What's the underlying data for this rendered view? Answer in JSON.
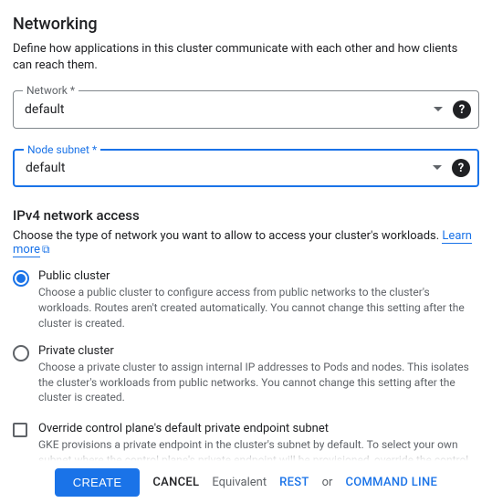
{
  "title": "Networking",
  "description": "Define how applications in this cluster communicate with each other and how clients can reach them.",
  "network_field": {
    "label": "Network *",
    "value": "default"
  },
  "subnet_field": {
    "label": "Node subnet *",
    "value": "default"
  },
  "ipv4": {
    "heading": "IPv4 network access",
    "desc": "Choose the type of network you want to allow to access your cluster's workloads.",
    "learn_more": "Learn more",
    "public": {
      "label": "Public cluster",
      "desc": "Choose a public cluster to configure access from public networks to the cluster's workloads. Routes aren't created automatically. You cannot change this setting after the cluster is created."
    },
    "private": {
      "label": "Private cluster",
      "desc": "Choose a private cluster to assign internal IP addresses to Pods and nodes. This isolates the cluster's workloads from public networks. You cannot change this setting after the cluster is created."
    }
  },
  "override": {
    "label": "Override control plane's default private endpoint subnet",
    "desc": "GKE provisions a private endpoint in the cluster's subnet by default. To select your own subnet where the control plane's private endpoint will be provisioned, override the control"
  },
  "footer": {
    "create": "CREATE",
    "cancel": "CANCEL",
    "equivalent": "Equivalent",
    "rest": "REST",
    "or": "or",
    "cmdline": "COMMAND LINE"
  }
}
